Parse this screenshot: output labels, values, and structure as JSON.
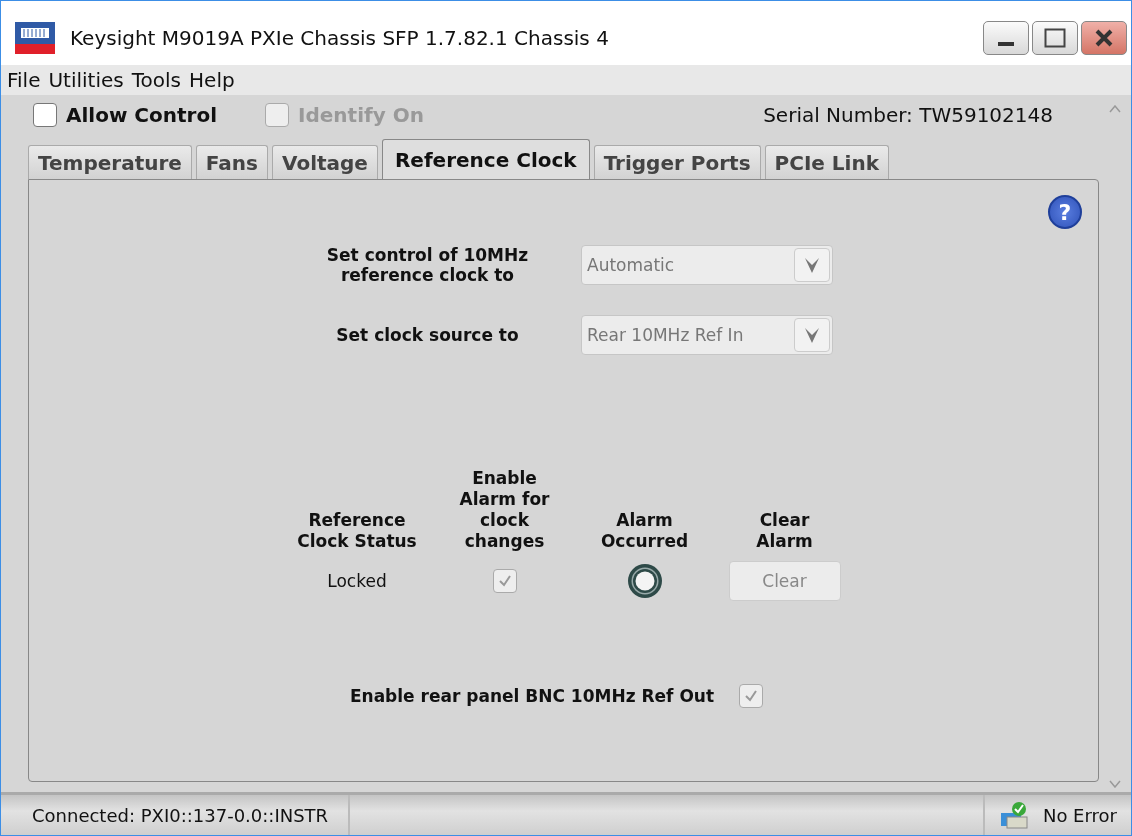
{
  "window": {
    "title": "Keysight M9019A PXIe Chassis SFP 1.7.82.1 Chassis 4"
  },
  "menu": [
    "File",
    "Utilities",
    "Tools",
    "Help"
  ],
  "controls": [
    {
      "label": "Allow Control",
      "checked": false,
      "disabled": false
    },
    {
      "label": "Identify On",
      "checked": false,
      "disabled": true
    }
  ],
  "serial_number": "Serial Number: TW59102148",
  "help_button": "?",
  "tabs": [
    {
      "label": "Temperature",
      "selected": false
    },
    {
      "label": "Fans",
      "selected": false
    },
    {
      "label": "Voltage",
      "selected": false
    },
    {
      "label": "Reference Clock",
      "selected": true
    },
    {
      "label": "Trigger Ports",
      "selected": false
    },
    {
      "label": "PCIe Link",
      "selected": false
    }
  ],
  "settings": [
    {
      "label": "Set control of 10MHz reference clock to",
      "value": "Automatic",
      "disabled": true
    },
    {
      "label": "Set clock source to",
      "value": "Rear 10MHz Ref In",
      "disabled": true
    }
  ],
  "alarm_table": {
    "columns": [
      "Reference Clock Status",
      "Enable Alarm for clock changes",
      "Alarm Occurred",
      "Clear Alarm"
    ],
    "status": "Locked",
    "enable_alarm": {
      "checked": true,
      "disabled": true
    },
    "alarm_occurred": {
      "on": false
    },
    "clear_button": {
      "label": "Clear",
      "disabled": true
    }
  },
  "rear_out": {
    "label": "Enable rear panel BNC 10MHz Ref Out",
    "checked": true,
    "disabled": true
  },
  "status_bar": {
    "connection": "Connected: PXI0::137-0.0::INSTR",
    "error": "No Error"
  }
}
